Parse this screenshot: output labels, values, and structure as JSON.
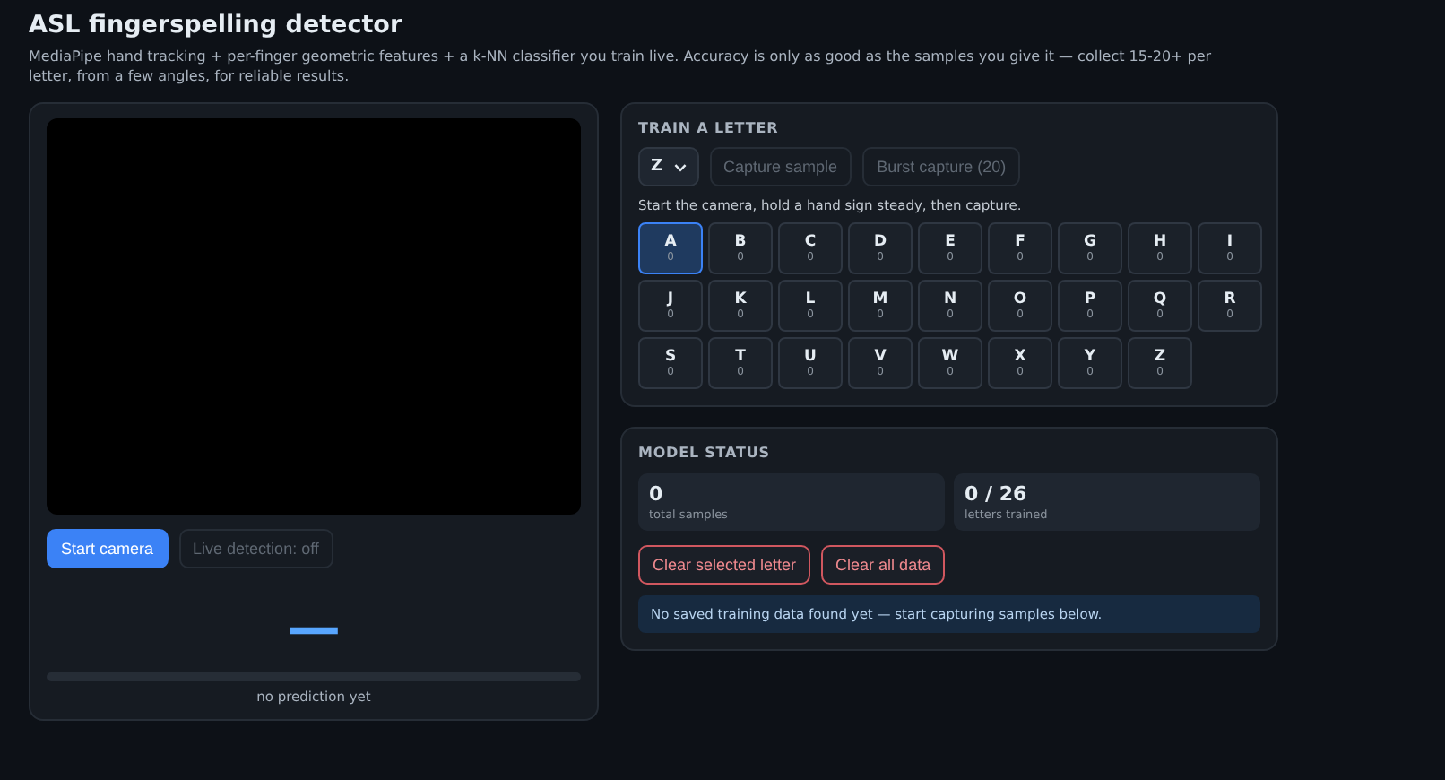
{
  "header": {
    "title": "ASL fingerspelling detector",
    "subtitle": "MediaPipe hand tracking + per-finger geometric features + a k-NN classifier you train live. Accuracy is only as good as the samples you give it — collect 15-20+ per letter, from a few angles, for reliable results."
  },
  "camera": {
    "buttons": [
      {
        "label": "Start camera",
        "kind": "primary",
        "disabled": false
      },
      {
        "label": "Live detection: off",
        "kind": "secondary",
        "disabled": true
      }
    ],
    "prediction": "—",
    "confidence": {
      "level": 0
    },
    "prediction_caption": "no prediction yet"
  },
  "train": {
    "heading": "TRAIN A LETTER",
    "letter_select": "Z",
    "buttons": [
      {
        "label": "Capture sample",
        "disabled": true
      },
      {
        "label": "Burst capture (20)",
        "disabled": true
      }
    ],
    "hint": "Start the camera, hold a hand sign steady, then capture.",
    "letters": [
      {
        "letter": "A",
        "count": "0",
        "selected": true
      },
      {
        "letter": "B",
        "count": "0",
        "selected": false
      },
      {
        "letter": "C",
        "count": "0",
        "selected": false
      },
      {
        "letter": "D",
        "count": "0",
        "selected": false
      },
      {
        "letter": "E",
        "count": "0",
        "selected": false
      },
      {
        "letter": "F",
        "count": "0",
        "selected": false
      },
      {
        "letter": "G",
        "count": "0",
        "selected": false
      },
      {
        "letter": "H",
        "count": "0",
        "selected": false
      },
      {
        "letter": "I",
        "count": "0",
        "selected": false
      },
      {
        "letter": "J",
        "count": "0",
        "selected": false
      },
      {
        "letter": "K",
        "count": "0",
        "selected": false
      },
      {
        "letter": "L",
        "count": "0",
        "selected": false
      },
      {
        "letter": "M",
        "count": "0",
        "selected": false
      },
      {
        "letter": "N",
        "count": "0",
        "selected": false
      },
      {
        "letter": "O",
        "count": "0",
        "selected": false
      },
      {
        "letter": "P",
        "count": "0",
        "selected": false
      },
      {
        "letter": "Q",
        "count": "0",
        "selected": false
      },
      {
        "letter": "R",
        "count": "0",
        "selected": false
      },
      {
        "letter": "S",
        "count": "0",
        "selected": false
      },
      {
        "letter": "T",
        "count": "0",
        "selected": false
      },
      {
        "letter": "U",
        "count": "0",
        "selected": false
      },
      {
        "letter": "V",
        "count": "0",
        "selected": false
      },
      {
        "letter": "W",
        "count": "0",
        "selected": false
      },
      {
        "letter": "X",
        "count": "0",
        "selected": false
      },
      {
        "letter": "Y",
        "count": "0",
        "selected": false
      },
      {
        "letter": "Z",
        "count": "0",
        "selected": false
      }
    ]
  },
  "model_status": {
    "heading": "MODEL STATUS",
    "stats": [
      {
        "value": "0",
        "label": "total samples"
      },
      {
        "value": "0 / 26",
        "label": "letters trained"
      }
    ],
    "buttons": [
      "Clear selected letter",
      "Clear all data"
    ],
    "notice": "No saved training data found yet — start capturing samples below."
  }
}
